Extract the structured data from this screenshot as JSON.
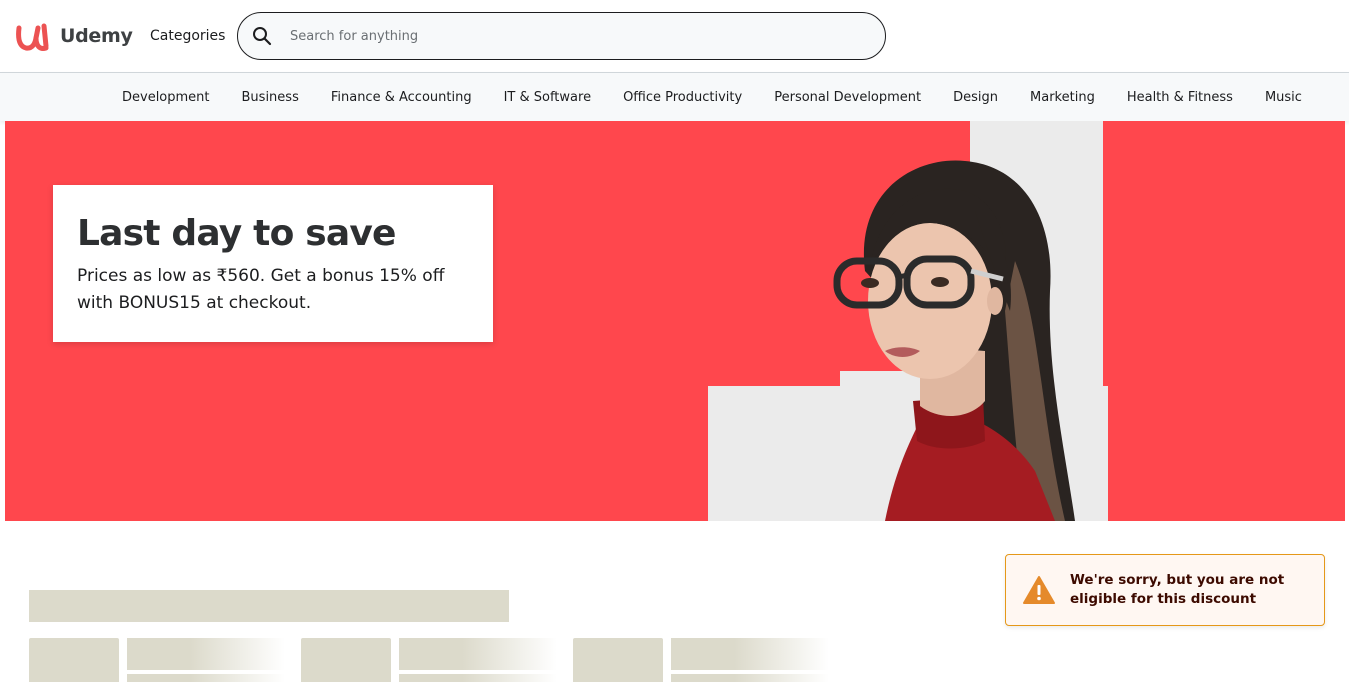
{
  "header": {
    "logo_text": "Udemy",
    "categories_label": "Categories",
    "search_placeholder": "Search for anything",
    "search_value": ""
  },
  "nav": {
    "items": [
      {
        "label": "Development"
      },
      {
        "label": "Business"
      },
      {
        "label": "Finance & Accounting"
      },
      {
        "label": "IT & Software"
      },
      {
        "label": "Office Productivity"
      },
      {
        "label": "Personal Development"
      },
      {
        "label": "Design"
      },
      {
        "label": "Marketing"
      },
      {
        "label": "Health & Fitness"
      },
      {
        "label": "Music"
      }
    ]
  },
  "hero": {
    "title": "Last day to save",
    "subtitle": "Prices as low as ₹560. Get a bonus 15% off with BONUS15 at checkout.",
    "background_color": "#ff474d"
  },
  "toast": {
    "message": "We're sorry, but you are not eligible for this discount",
    "icon": "warning-icon",
    "accent_color": "#e59819"
  },
  "colors": {
    "brand": "#a435f0",
    "logo_red": "#ec5252",
    "skeleton": "#dcdacb"
  }
}
